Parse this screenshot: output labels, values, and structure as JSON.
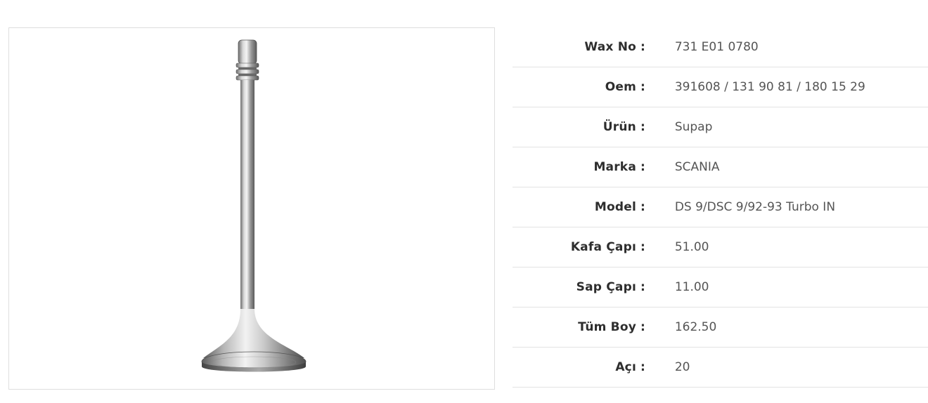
{
  "product_image": {
    "icon": "engine-valve-image"
  },
  "specs": [
    {
      "label": "Wax No",
      "value": "731 E01 0780"
    },
    {
      "label": "Oem",
      "value": "391608 / 131 90 81 / 180 15 29"
    },
    {
      "label": "Ürün",
      "value": "Supap"
    },
    {
      "label": "Marka",
      "value": "SCANIA"
    },
    {
      "label": "Model",
      "value": "DS 9/DSC 9/92-93 Turbo IN"
    },
    {
      "label": "Kafa Çapı",
      "value": "51.00"
    },
    {
      "label": "Sap Çapı",
      "value": "11.00"
    },
    {
      "label": "Tüm Boy",
      "value": "162.50"
    },
    {
      "label": "Açı",
      "value": "20"
    }
  ],
  "separator": ":"
}
